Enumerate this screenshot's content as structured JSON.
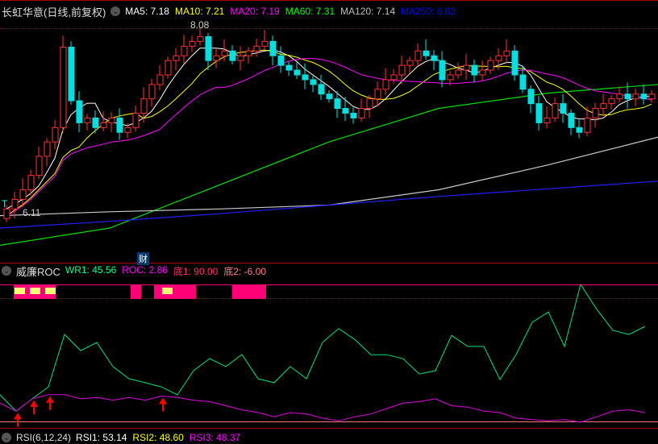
{
  "main": {
    "title": "长虹华意(日线,前复权)",
    "ma": [
      {
        "label": "MA5: 7.18",
        "color": "#ffffff"
      },
      {
        "label": "MA10: 7.21",
        "color": "#ffff00"
      },
      {
        "label": "MA20: 7.19",
        "color": "#ff00ff"
      },
      {
        "label": "MA60: 7.31",
        "color": "#00ff00"
      },
      {
        "label": "MA120: 7.14",
        "color": "#c0c0c0"
      },
      {
        "label": "MA250: 6.62",
        "color": "#0000ff"
      }
    ],
    "high_label": "8.08",
    "low_label": "6.11",
    "high": 8.08,
    "low": 6.11,
    "badge": "财",
    "closes": [
      6.15,
      6.25,
      6.35,
      6.5,
      6.7,
      6.85,
      7.0,
      7.84,
      7.28,
      7.05,
      7.1,
      7.0,
      7.05,
      7.1,
      6.95,
      7.0,
      7.15,
      7.3,
      7.45,
      7.55,
      7.7,
      7.75,
      7.85,
      7.9,
      7.95,
      7.7,
      7.75,
      7.8,
      7.7,
      7.75,
      7.8,
      7.85,
      7.9,
      7.75,
      7.65,
      7.6,
      7.55,
      7.5,
      7.45,
      7.35,
      7.3,
      7.2,
      7.15,
      7.1,
      7.2,
      7.3,
      7.4,
      7.5,
      7.55,
      7.65,
      7.7,
      7.8,
      7.75,
      7.7,
      7.5,
      7.55,
      7.6,
      7.65,
      7.55,
      7.6,
      7.7,
      7.75,
      7.8,
      7.55,
      7.4,
      7.25,
      7.05,
      7.1,
      7.25,
      7.15,
      7.0,
      6.95,
      7.1,
      7.2,
      7.25,
      7.3,
      7.35,
      7.3,
      7.35,
      7.3,
      7.35
    ],
    "ma60": [
      5.77,
      5.95,
      6.4,
      6.85,
      7.2,
      7.36,
      7.45
    ],
    "ma120": [
      6.08,
      6.12,
      6.15,
      6.19,
      6.35,
      6.61,
      6.9
    ],
    "ma250": [
      5.95,
      6.02,
      6.1,
      6.19,
      6.28,
      6.36,
      6.44
    ]
  },
  "indicator": {
    "name": "威廉ROC",
    "values": [
      {
        "label": "WR1: 45.56",
        "color": "#00ff80"
      },
      {
        "label": "ROC: 2.86",
        "color": "#ff00ff"
      },
      {
        "label": "底1: 90.00",
        "color": "#ff3070"
      },
      {
        "label": "底2: -6.00",
        "color": "#ff8080"
      }
    ],
    "wr": [
      19.9,
      8,
      17,
      25.7,
      63.7,
      52,
      57.9,
      40.4,
      31.6,
      28.7,
      25.7,
      19.9,
      37.4,
      46.2,
      40.4,
      49.1,
      31.6,
      28.7,
      40.4,
      31.6,
      58,
      68,
      60,
      49,
      49,
      46,
      35,
      37.4,
      63,
      55,
      55,
      31,
      49.1,
      72.5,
      80,
      55,
      100,
      82,
      66.7,
      63.7,
      69.6
    ],
    "roc": [
      14,
      8,
      17,
      20,
      20,
      17,
      18,
      16,
      18,
      16,
      19,
      18,
      16,
      15,
      12,
      9,
      7,
      4,
      7,
      6,
      3,
      1,
      4,
      6,
      10,
      14,
      15,
      17,
      12,
      11,
      8,
      7,
      3,
      2,
      1,
      2,
      0,
      4,
      8,
      9,
      7
    ],
    "arrows": [
      1,
      2,
      3,
      10
    ]
  },
  "rsi": {
    "name": "RSI(6,12,24)",
    "values": [
      {
        "label": "RSI1: 53.14",
        "color": "#ffffff"
      },
      {
        "label": "RSI2: 48.60",
        "color": "#ffff00"
      },
      {
        "label": "RSI3: 48.37",
        "color": "#ff00ff"
      }
    ]
  }
}
